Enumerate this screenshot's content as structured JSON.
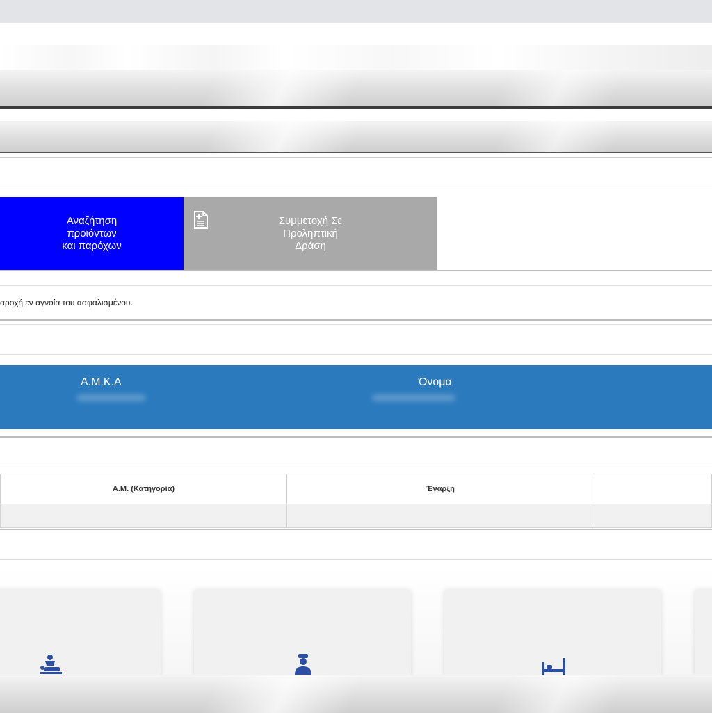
{
  "tiles": [
    {
      "label": "Αναζήτηση\nπροϊόντων\nκαι παρόχων",
      "color": "#0000fe",
      "icon": ""
    },
    {
      "label": "Συμμετοχή Σε\nΠροληπτική\nΔράση",
      "color": "#a9a9a9",
      "icon": "document-plus-icon"
    }
  ],
  "notice": "αροχή εν αγνοία του ασφαλισμένου.",
  "insured_panel": {
    "color": "#2a7abd",
    "amka_label": "Α.Μ.Κ.Α",
    "name_label": "Όνομα"
  },
  "insurance_table": {
    "columns": [
      "Α.Μ. (Κατηγορία)",
      "Έναρξη",
      ""
    ]
  },
  "service_cards": [
    {
      "icon": "massage-therapy-icon"
    },
    {
      "icon": "nurse-icon"
    },
    {
      "icon": "hospital-bed-icon"
    },
    {
      "icon": ""
    }
  ]
}
